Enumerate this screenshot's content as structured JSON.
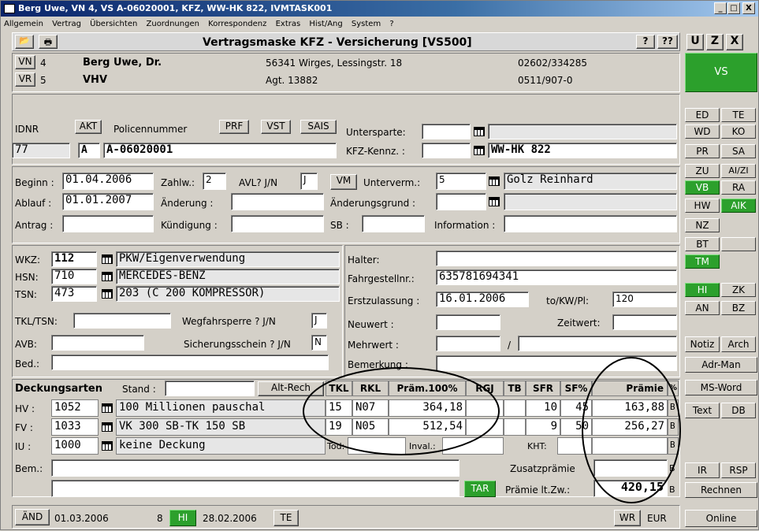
{
  "window": {
    "title": "Berg Uwe, VN 4, VS A-06020001, KFZ, WW-HK 822, IVMTASK001",
    "min": "_",
    "max": "□",
    "close": "X"
  },
  "menu": [
    "Allgemein",
    "Vertrag",
    "Übersichten",
    "Zuordnungen",
    "Korrespondenz",
    "Extras",
    "Hist/Ang",
    "System",
    "?"
  ],
  "toolbar": {
    "heading": "Vertragsmaske  KFZ - Versicherung  [VS500]",
    "help": "?",
    "help2": "??",
    "u": "U",
    "z": "Z",
    "x": "X"
  },
  "vn": {
    "btn": "VN",
    "num": "4",
    "name": "Berg Uwe, Dr.",
    "addr": "56341 Wirges, Lessingstr. 18",
    "phone": "02602/334285"
  },
  "vr": {
    "btn": "VR",
    "num": "5",
    "name": "VHV",
    "agt": "Agt. 13882",
    "phone": "0511/907-0"
  },
  "ids": {
    "idnr_label": "IDNR",
    "akt": "AKT",
    "police_label": "Policennummer",
    "prf": "PRF",
    "vst": "VST",
    "sais": "SAIS",
    "idnr": "77",
    "status": "A",
    "police": "A-06020001"
  },
  "sparte": {
    "untersparte_label": "Untersparte:",
    "kennz_label": "KFZ-Kennz. :",
    "kennz": "WW-HK  822"
  },
  "dates": {
    "beginn_label": "Beginn :",
    "beginn": "01.04.2006",
    "zahlw_label": "Zahlw.:",
    "zahlw": "2",
    "avl_label": "AVL? J/N",
    "avl": "J",
    "vm": "VM",
    "unterverm_label": "Unterverm.:",
    "unterverm": "5",
    "unterverm_name": "Golz Reinhard",
    "ablauf_label": "Ablauf :",
    "ablauf": "01.01.2007",
    "aenderung_label": "Änderung :",
    "aenderungsgrund_label": "Änderungsgrund :",
    "antrag_label": "Antrag :",
    "kuendigung_label": "Kündigung :",
    "sb_label": "SB :",
    "info_label": "Information :"
  },
  "vehicle": {
    "wkz_label": "WKZ:",
    "wkz": "112",
    "wkz_text": "PKW/Eigenverwendung",
    "hsn_label": "HSN:",
    "hsn": "710",
    "hsn_text": "MERCEDES-BENZ",
    "tsn_label": "TSN:",
    "tsn": "473",
    "tsn_text": "203 (C 200 KOMPRESSOR)",
    "tkl_label": "TKL/TSN:",
    "wegfahr_label": "Wegfahrsperre ?   J/N",
    "wegfahr": "J",
    "avb_label": "AVB:",
    "sicher_label": "Sicherungsschein ? J/N",
    "sicher": "N",
    "bed_label": "Bed.:"
  },
  "holder": {
    "halter_label": "Halter:",
    "fgst_label": "Fahrgestellnr.:",
    "fgst": "635781694341",
    "erstzu_label": "Erstzulassung :",
    "erstzu": "16.01.2006",
    "tokw_label": "to/KW/Pl:",
    "tokw": "120",
    "neuwert_label": "Neuwert :",
    "zeitwert_label": "Zeitwert:",
    "mehrwert_label": "Mehrwert :",
    "slash": "/",
    "bemerkung_label": "Bemerkung :"
  },
  "coverage": {
    "title": "Deckungsarten",
    "stand_label": "Stand :",
    "altrech": "Alt-Rech",
    "cols": [
      "TKL",
      "RKL",
      "Präm.100%",
      "RGJ",
      "TB",
      "SFR",
      "SF%",
      "Prämie",
      "%"
    ],
    "rows": [
      {
        "label": "HV :",
        "code": "1052",
        "text": "100 Millionen pauschal",
        "tkl": "15",
        "rkl": "N07",
        "praem": "364,18",
        "sfr": "10",
        "sfp": "45",
        "praemie": "163,88",
        "flag": "B"
      },
      {
        "label": "FV :",
        "code": "1033",
        "text": "VK    300 SB-TK 150 SB",
        "tkl": "19",
        "rkl": "N05",
        "praem": "512,54",
        "sfr": "9",
        "sfp": "50",
        "praemie": "256,27",
        "flag": "B"
      },
      {
        "label": "IU :",
        "code": "1000",
        "text": "keine Deckung",
        "tod": "Tod:",
        "inval": "Inval.:",
        "kht": "KHT:",
        "flag": "B"
      }
    ],
    "bem_label": "Bem.:",
    "zusatz_label": "Zusatzprämie",
    "zusatz_flag": "B",
    "tar": "TAR",
    "praemie_zw_label": "Prämie lt.Zw.:",
    "praemie_zw": "420,15",
    "praemie_zw_flag": "B"
  },
  "status": {
    "aend": "ÄND",
    "date1": "01.03.2006",
    "num": "8",
    "hi": "HI",
    "date2": "28.02.2006",
    "te": "TE",
    "wr": "WR",
    "cur": "EUR"
  },
  "side": {
    "vs": "VS",
    "ed": "ED",
    "te": "TE",
    "wd": "WD",
    "ko": "KO",
    "pr": "PR",
    "sa": "SA",
    "zu": "ZU",
    "aizi": "AI/ZI",
    "vb": "VB",
    "ra": "RA",
    "hw": "HW",
    "aik": "AIK",
    "nz": "NZ",
    "bt": "BT",
    "tm": "TM",
    "hi": "HI",
    "zk": "ZK",
    "an": "AN",
    "bz": "BZ",
    "notiz": "Notiz",
    "arch": "Arch",
    "adrman": "Adr-Man",
    "msword": "MS-Word",
    "text": "Text",
    "db": "DB",
    "ir": "IR",
    "rsp": "RSP",
    "rechnen": "Rechnen",
    "online": "Online"
  },
  "colors": {
    "green": "#2ca02c",
    "title": "#0a246a",
    "bg": "#d4d0c8"
  }
}
